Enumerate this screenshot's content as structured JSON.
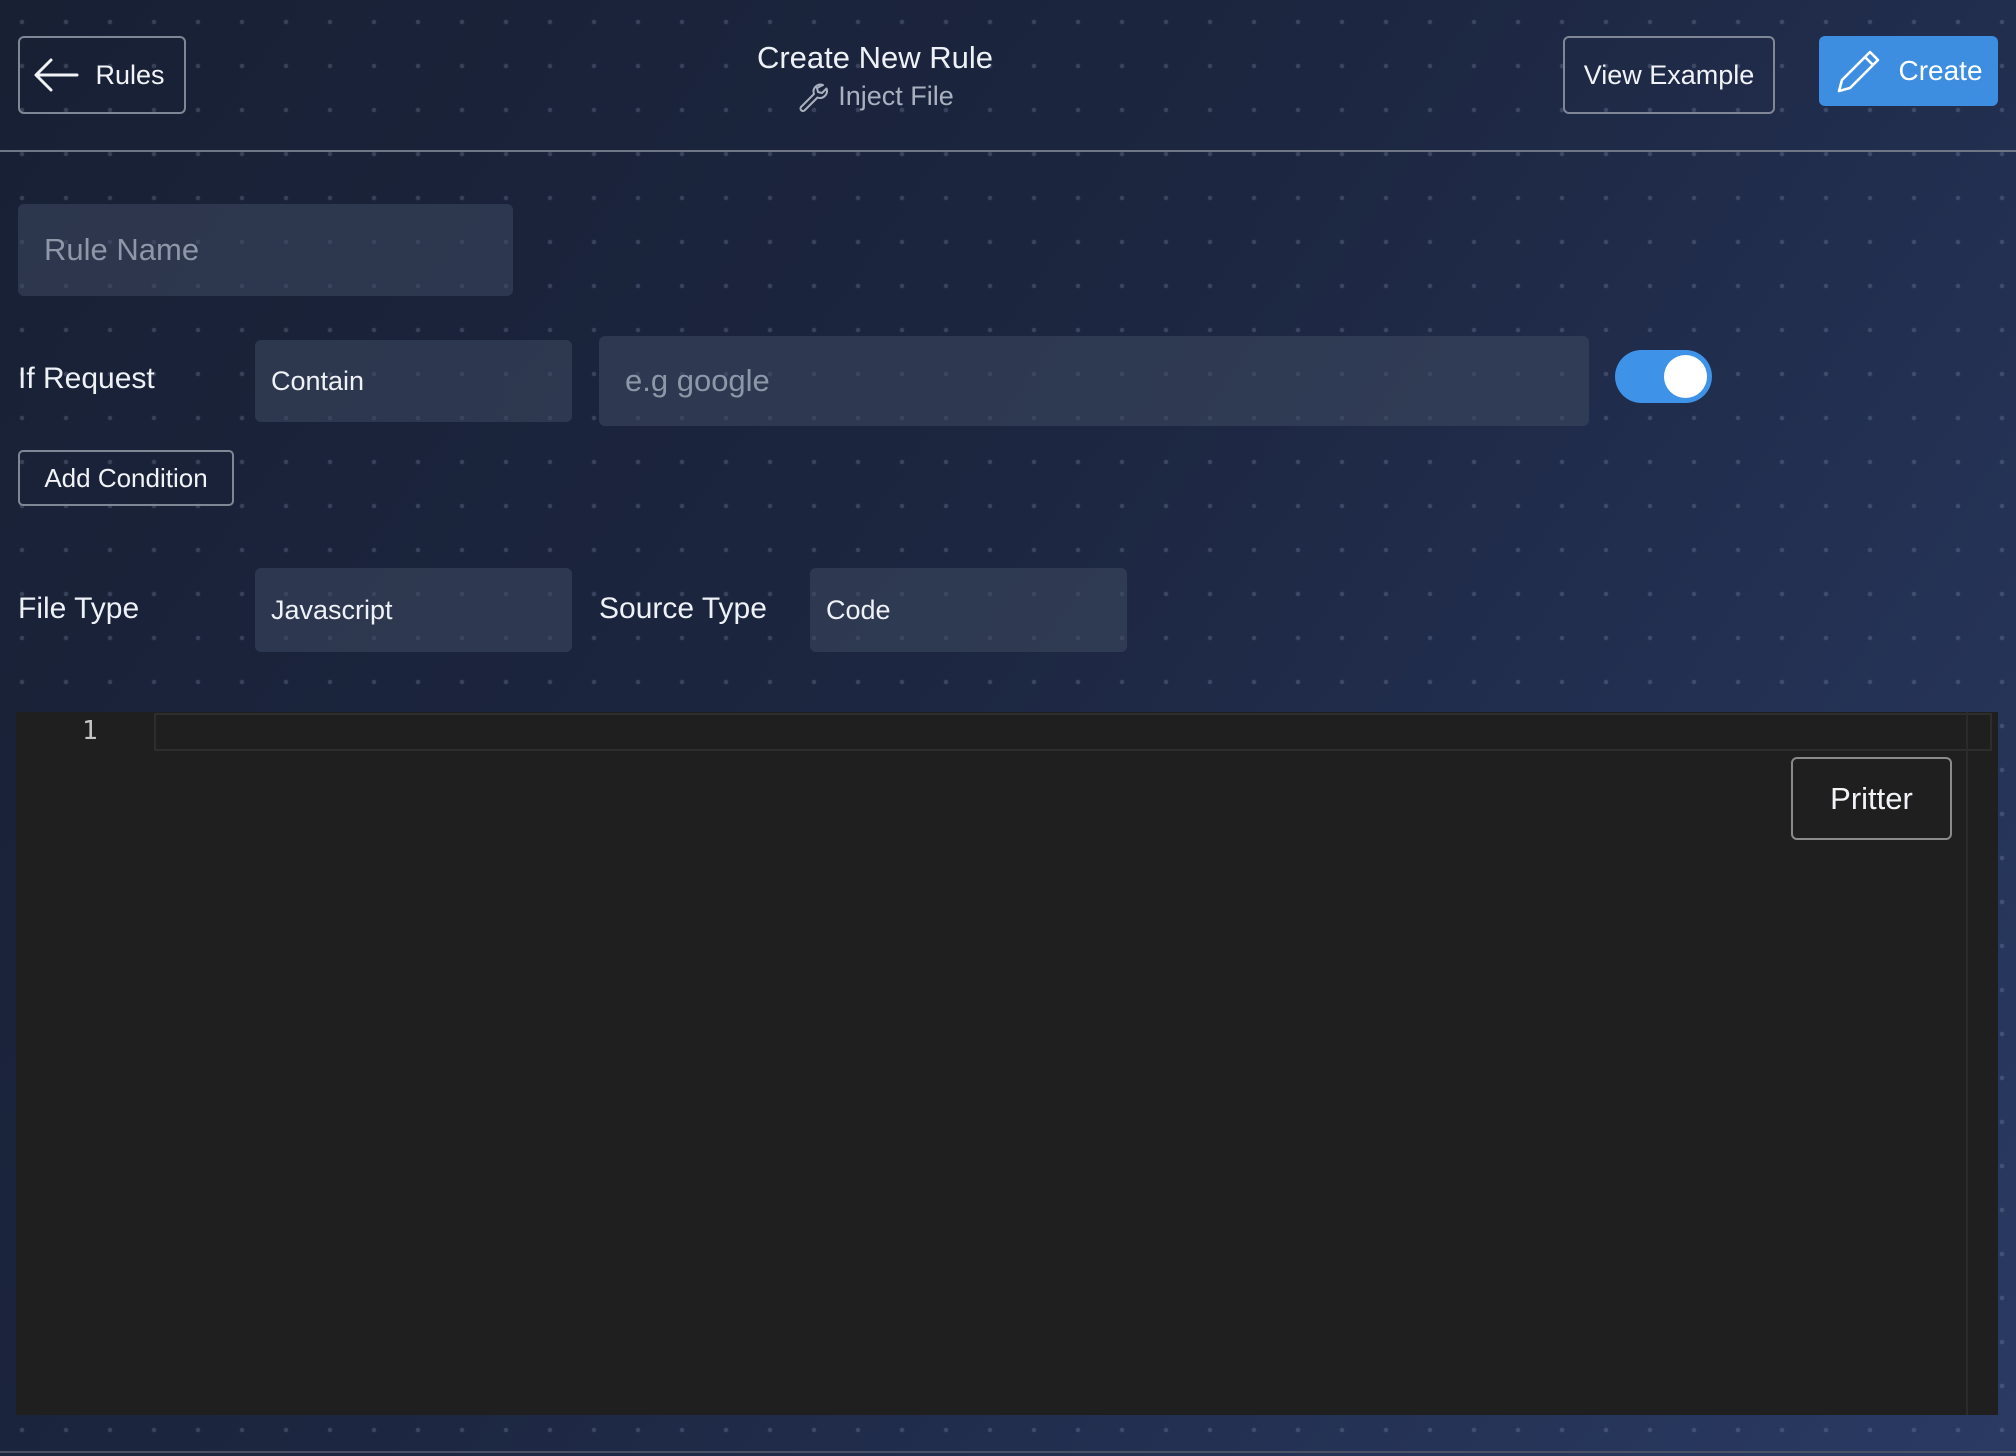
{
  "header": {
    "back_label": "Rules",
    "title": "Create New Rule",
    "subtitle": "Inject File",
    "view_example_label": "View Example",
    "create_label": "Create"
  },
  "form": {
    "rule_name_placeholder": "Rule Name",
    "if_request_label": "If Request",
    "condition_operator": "Contain",
    "condition_value_placeholder": "e.g google",
    "condition_enabled": true,
    "add_condition_label": "Add Condition",
    "file_type_label": "File Type",
    "file_type_value": "Javascript",
    "source_type_label": "Source Type",
    "source_type_value": "Code"
  },
  "editor": {
    "line_numbers": [
      "1"
    ],
    "prettier_label": "Pritter"
  },
  "colors": {
    "accent": "#3d8ee0",
    "background": "#1c2640",
    "editor_background": "#1f1f1f"
  },
  "icons": {
    "back": "arrow-left-icon",
    "subtitle": "wrench-icon",
    "create": "pencil-icon"
  }
}
